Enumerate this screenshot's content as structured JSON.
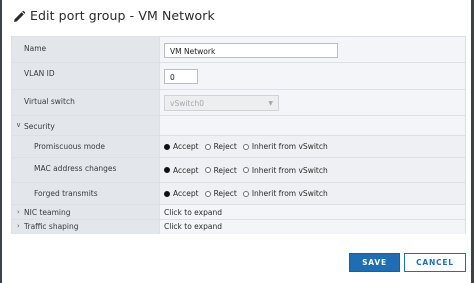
{
  "dialog": {
    "title": "Edit port group - VM Network",
    "title_icon": "pencil-icon"
  },
  "form": {
    "name": {
      "label": "Name",
      "value": "VM Network"
    },
    "vlan_id": {
      "label": "VLAN ID",
      "value": "0"
    },
    "virtual_switch": {
      "label": "Virtual switch",
      "value": "vSwitch0",
      "disabled": true
    },
    "security": {
      "label": "Security",
      "expanded": true,
      "promiscuous_mode": {
        "label": "Promiscuous mode",
        "selected": "Accept"
      },
      "mac_address_changes": {
        "label": "MAC address changes",
        "selected": "Accept"
      },
      "forged_transmits": {
        "label": "Forged transmits",
        "selected": "Accept"
      },
      "options": [
        "Accept",
        "Reject",
        "Inherit from vSwitch"
      ]
    },
    "nic_teaming": {
      "label": "NIC teaming",
      "value": "Click to expand",
      "expanded": false
    },
    "traffic_shaping": {
      "label": "Traffic shaping",
      "value": "Click to expand",
      "expanded": false
    }
  },
  "footer": {
    "save_label": "SAVE",
    "cancel_label": "CANCEL"
  },
  "colors": {
    "primary": "#1f6eb3",
    "label_bg": "#e3e7ec",
    "value_bg": "#f3f5f8"
  }
}
